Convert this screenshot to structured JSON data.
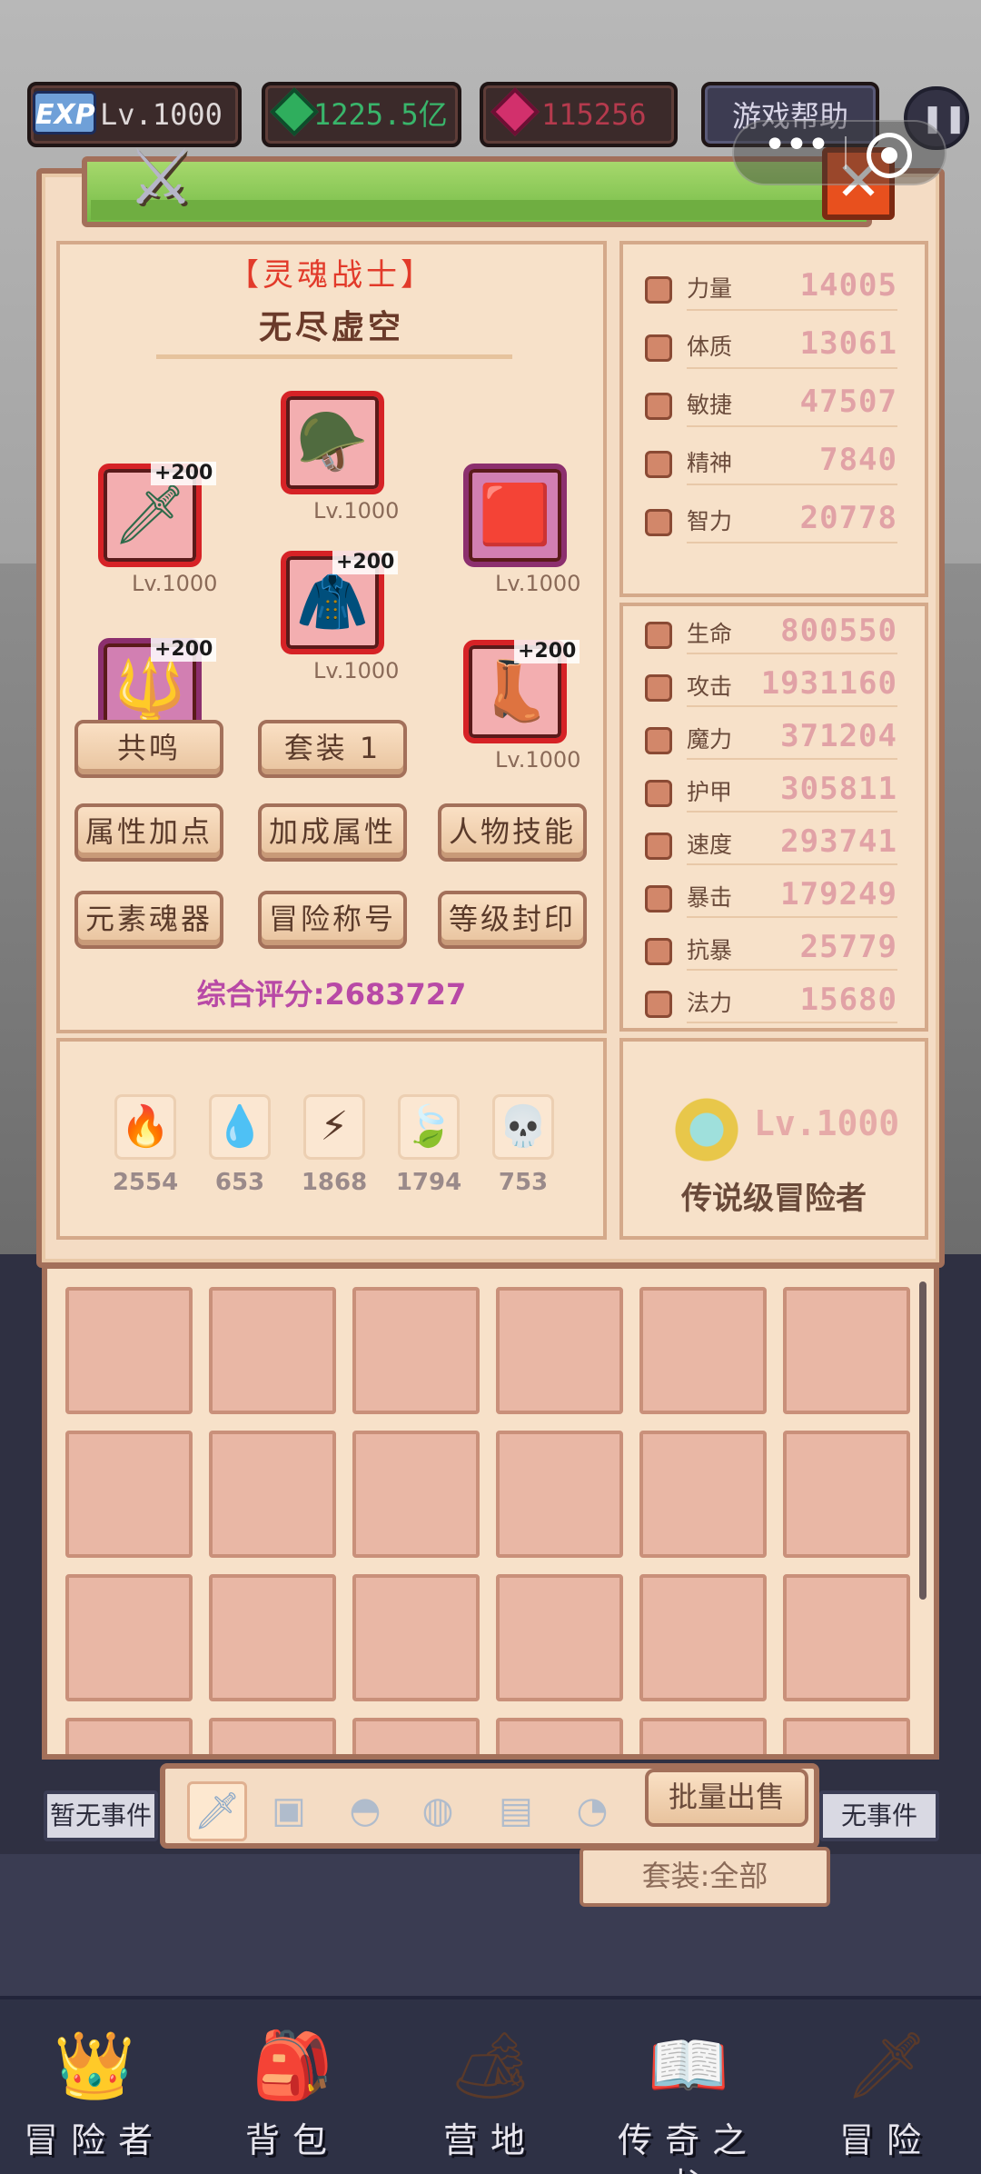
{
  "hud": {
    "exp_badge": "EXP",
    "level": "Lv.1000",
    "gems": "1225.5亿",
    "rubies": "115256",
    "help": "游戏帮助",
    "pause_glyph": "❚❚"
  },
  "capsule": {
    "more": "•••"
  },
  "header": {
    "close_glyph": "✕",
    "swords_glyph": "⚔"
  },
  "character": {
    "class_title": "【灵魂战士】",
    "name": "无尽虚空",
    "score": "综合评分:2683727"
  },
  "equipment": [
    {
      "name": "weapon",
      "icon": "🗡",
      "bonus": "+200",
      "level": "Lv.1000",
      "rarity": "red"
    },
    {
      "name": "helmet",
      "icon": "🪖",
      "bonus": "",
      "level": "Lv.1000",
      "rarity": "red"
    },
    {
      "name": "artifact",
      "icon": "🟥",
      "bonus": "",
      "level": "Lv.1000",
      "rarity": "purple"
    },
    {
      "name": "armor",
      "icon": "🧥",
      "bonus": "+200",
      "level": "Lv.1000",
      "rarity": "red"
    },
    {
      "name": "gloves",
      "icon": "🔱",
      "bonus": "+200",
      "level": "",
      "rarity": "purple"
    },
    {
      "name": "boots",
      "icon": "👢",
      "bonus": "+200",
      "level": "Lv.1000",
      "rarity": "red"
    }
  ],
  "buttons": {
    "resonance": "共鸣",
    "set": "套装 1",
    "attribute_points": "属性加点",
    "bonus_attributes": "加成属性",
    "character_skills": "人物技能",
    "element_soul": "元素魂器",
    "adventure_title": "冒险称号",
    "level_seal": "等级封印"
  },
  "base_stats": [
    {
      "label": "力量",
      "value": "14005"
    },
    {
      "label": "体质",
      "value": "13061"
    },
    {
      "label": "敏捷",
      "value": "47507"
    },
    {
      "label": "精神",
      "value": "7840"
    },
    {
      "label": "智力",
      "value": "20778"
    }
  ],
  "combat_stats": [
    {
      "label": "生命",
      "value": "800550"
    },
    {
      "label": "攻击",
      "value": "1931160"
    },
    {
      "label": "魔力",
      "value": "371204"
    },
    {
      "label": "护甲",
      "value": "305811"
    },
    {
      "label": "速度",
      "value": "293741"
    },
    {
      "label": "暴击",
      "value": "179249"
    },
    {
      "label": "抗暴",
      "value": "25779"
    },
    {
      "label": "法力",
      "value": "15680"
    }
  ],
  "elements": [
    {
      "name": "fire",
      "icon": "🔥",
      "count": "2554"
    },
    {
      "name": "water",
      "icon": "💧",
      "count": "653"
    },
    {
      "name": "thunder",
      "icon": "⚡",
      "count": "1868"
    },
    {
      "name": "earth",
      "icon": "🍃",
      "count": "1794"
    },
    {
      "name": "dark",
      "icon": "💀",
      "count": "753"
    }
  ],
  "rank": {
    "level": "Lv.1000",
    "title": "传说级冒险者"
  },
  "inventory": {
    "columns": 6
  },
  "tabs": {
    "weapon": "🗡",
    "armor": "▣",
    "helmet": "◓",
    "chest": "◍",
    "pants": "▤",
    "ring": "◔",
    "bulk_sell": "批量出售",
    "set_filter": "套装:全部"
  },
  "events": {
    "left": "暂无事件",
    "right": "无事件"
  },
  "nav": [
    {
      "label": "冒险者",
      "icon": "👑"
    },
    {
      "label": "背包",
      "icon": "🎒"
    },
    {
      "label": "营地",
      "icon": "🏕"
    },
    {
      "label": "传奇之书",
      "icon": "📖"
    },
    {
      "label": "冒险",
      "icon": "🗡"
    }
  ]
}
